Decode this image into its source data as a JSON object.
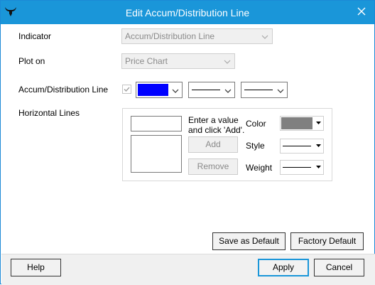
{
  "window": {
    "title": "Edit Accum/Distribution Line",
    "accent_color": "#1a96d9",
    "app_icon": "bull-icon",
    "close_icon": "close-icon"
  },
  "form": {
    "indicator": {
      "label": "Indicator",
      "value": "Accum/Distribution Line"
    },
    "plot_on": {
      "label": "Plot on",
      "value": "Price Chart"
    },
    "line": {
      "label": "Accum/Distribution Line",
      "checked": true,
      "color": "#0000ff"
    },
    "horizontal_lines": {
      "label": "Horizontal Lines",
      "hint": "Enter a value and click 'Add'.",
      "value": "",
      "add_label": "Add",
      "remove_label": "Remove",
      "color_label": "Color",
      "color_value": "#808080",
      "style_label": "Style",
      "weight_label": "Weight"
    }
  },
  "buttons": {
    "save_default": "Save as Default",
    "factory_default": "Factory Default",
    "help": "Help",
    "apply": "Apply",
    "cancel": "Cancel"
  }
}
